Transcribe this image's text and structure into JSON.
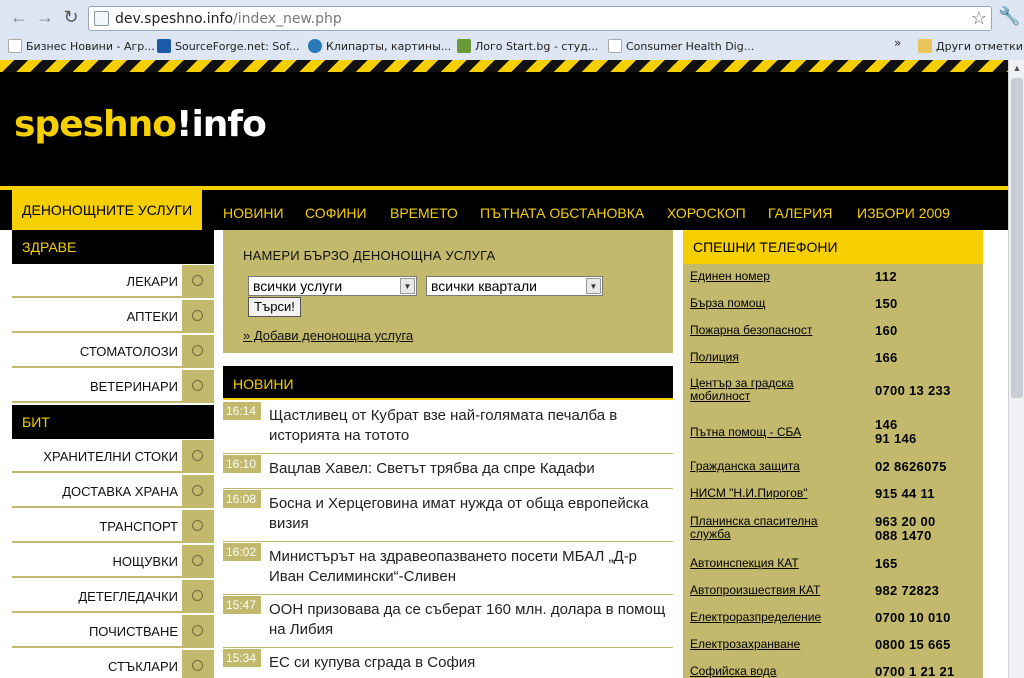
{
  "browser": {
    "url_host": "dev.speshno.info",
    "url_path": "/index_new.php",
    "bookmarks": [
      {
        "label": "Бизнес Новини - Агр...",
        "color": "#c4352b"
      },
      {
        "label": "SourceForge.net: Sof...",
        "color": "#1c5aa6"
      },
      {
        "label": "Клипарты, картины...",
        "color": "#2a7ab8"
      },
      {
        "label": "Лого Start.bg - студ...",
        "color": "#6a9a3a"
      },
      {
        "label": "Consumer Health Dig...",
        "color": "#e6e6e6"
      }
    ],
    "more": "»",
    "other_bookmarks": "Други отметки"
  },
  "logo": {
    "part1": "speshno",
    "part2": "!",
    "part3": "info"
  },
  "nav": {
    "active": "ДЕНОНОЩНИТЕ УСЛУГИ",
    "items": [
      "НОВИНИ",
      "СОФИНИ",
      "ВРЕМЕТО",
      "ПЪТНАТА ОБСТАНОВКА",
      "ХОРОСКОП",
      "ГАЛЕРИЯ",
      "ИЗБОРИ 2009"
    ]
  },
  "sidebar": {
    "health_title": "ЗДРАВЕ",
    "health_items": [
      "ЛЕКАРИ",
      "АПТЕКИ",
      "СТОМАТОЛОЗИ",
      "ВЕТЕРИНАРИ"
    ],
    "home_title": "БИТ",
    "home_items": [
      "ХРАНИТЕЛНИ СТОКИ",
      "ДОСТАВКА ХРАНА",
      "ТРАНСПОРТ",
      "НОЩУВКИ",
      "ДЕТЕГЛЕДАЧКИ",
      "ПОЧИСТВАНЕ",
      "СТЪКЛАРИ"
    ]
  },
  "search": {
    "title": "НАМЕРИ БЪРЗО ДЕНОНОЩНА УСЛУГА",
    "service_select": "всички услуги",
    "district_select": "всички квартали",
    "button": "Търси!",
    "add_link": "» Добави денонощна услуга"
  },
  "news": {
    "title": "НОВИНИ",
    "items": [
      {
        "time": "16:14",
        "text": "Щастливец от Кубрат взе най-голямата печалба в историята на тотото"
      },
      {
        "time": "16:10",
        "text": "Вацлав Хавел: Светът трябва да спре Кадафи"
      },
      {
        "time": "16:08",
        "text": "Босна и Херцеговина имат нужда от обща европейска визия"
      },
      {
        "time": "16:02",
        "text": "Министърът на здравеопазването посети МБАЛ „Д-р Иван Селимински“-Сливен"
      },
      {
        "time": "15:47",
        "text": "ООН призовава да се съберат 160 млн. долара в помощ на Либия"
      },
      {
        "time": "15:34",
        "text": "ЕС си купува сграда в София"
      }
    ]
  },
  "phones": {
    "title": "СПЕШНИ ТЕЛЕФОНИ",
    "items": [
      {
        "name": "Единен номер",
        "number": "112"
      },
      {
        "name": "Бърза помощ",
        "number": "150"
      },
      {
        "name": "Пожарна безопасност",
        "number": "160"
      },
      {
        "name": "Полиция",
        "number": "166"
      },
      {
        "name": "Център за градска мобилност",
        "number": "0700 13 233"
      },
      {
        "name": "Пътна помощ - СБА",
        "number": "146\n91 146"
      },
      {
        "name": "Гражданска защита",
        "number": "02 8626075"
      },
      {
        "name": "НИСМ \"Н.И.Пирогов\"",
        "number": "915 44 11"
      },
      {
        "name": "Планинска спасителна служба",
        "number": "963 20 00\n088 1470"
      },
      {
        "name": "Автоинспекция КАТ",
        "number": "165"
      },
      {
        "name": "Автопроизшествия КАТ",
        "number": "982 72823"
      },
      {
        "name": "Електроразпределение",
        "number": "0700 10 010"
      },
      {
        "name": "Електрозахранване",
        "number": "0800 15 665"
      },
      {
        "name": "Софийска вода",
        "number": "0700 1 21 21"
      }
    ]
  }
}
